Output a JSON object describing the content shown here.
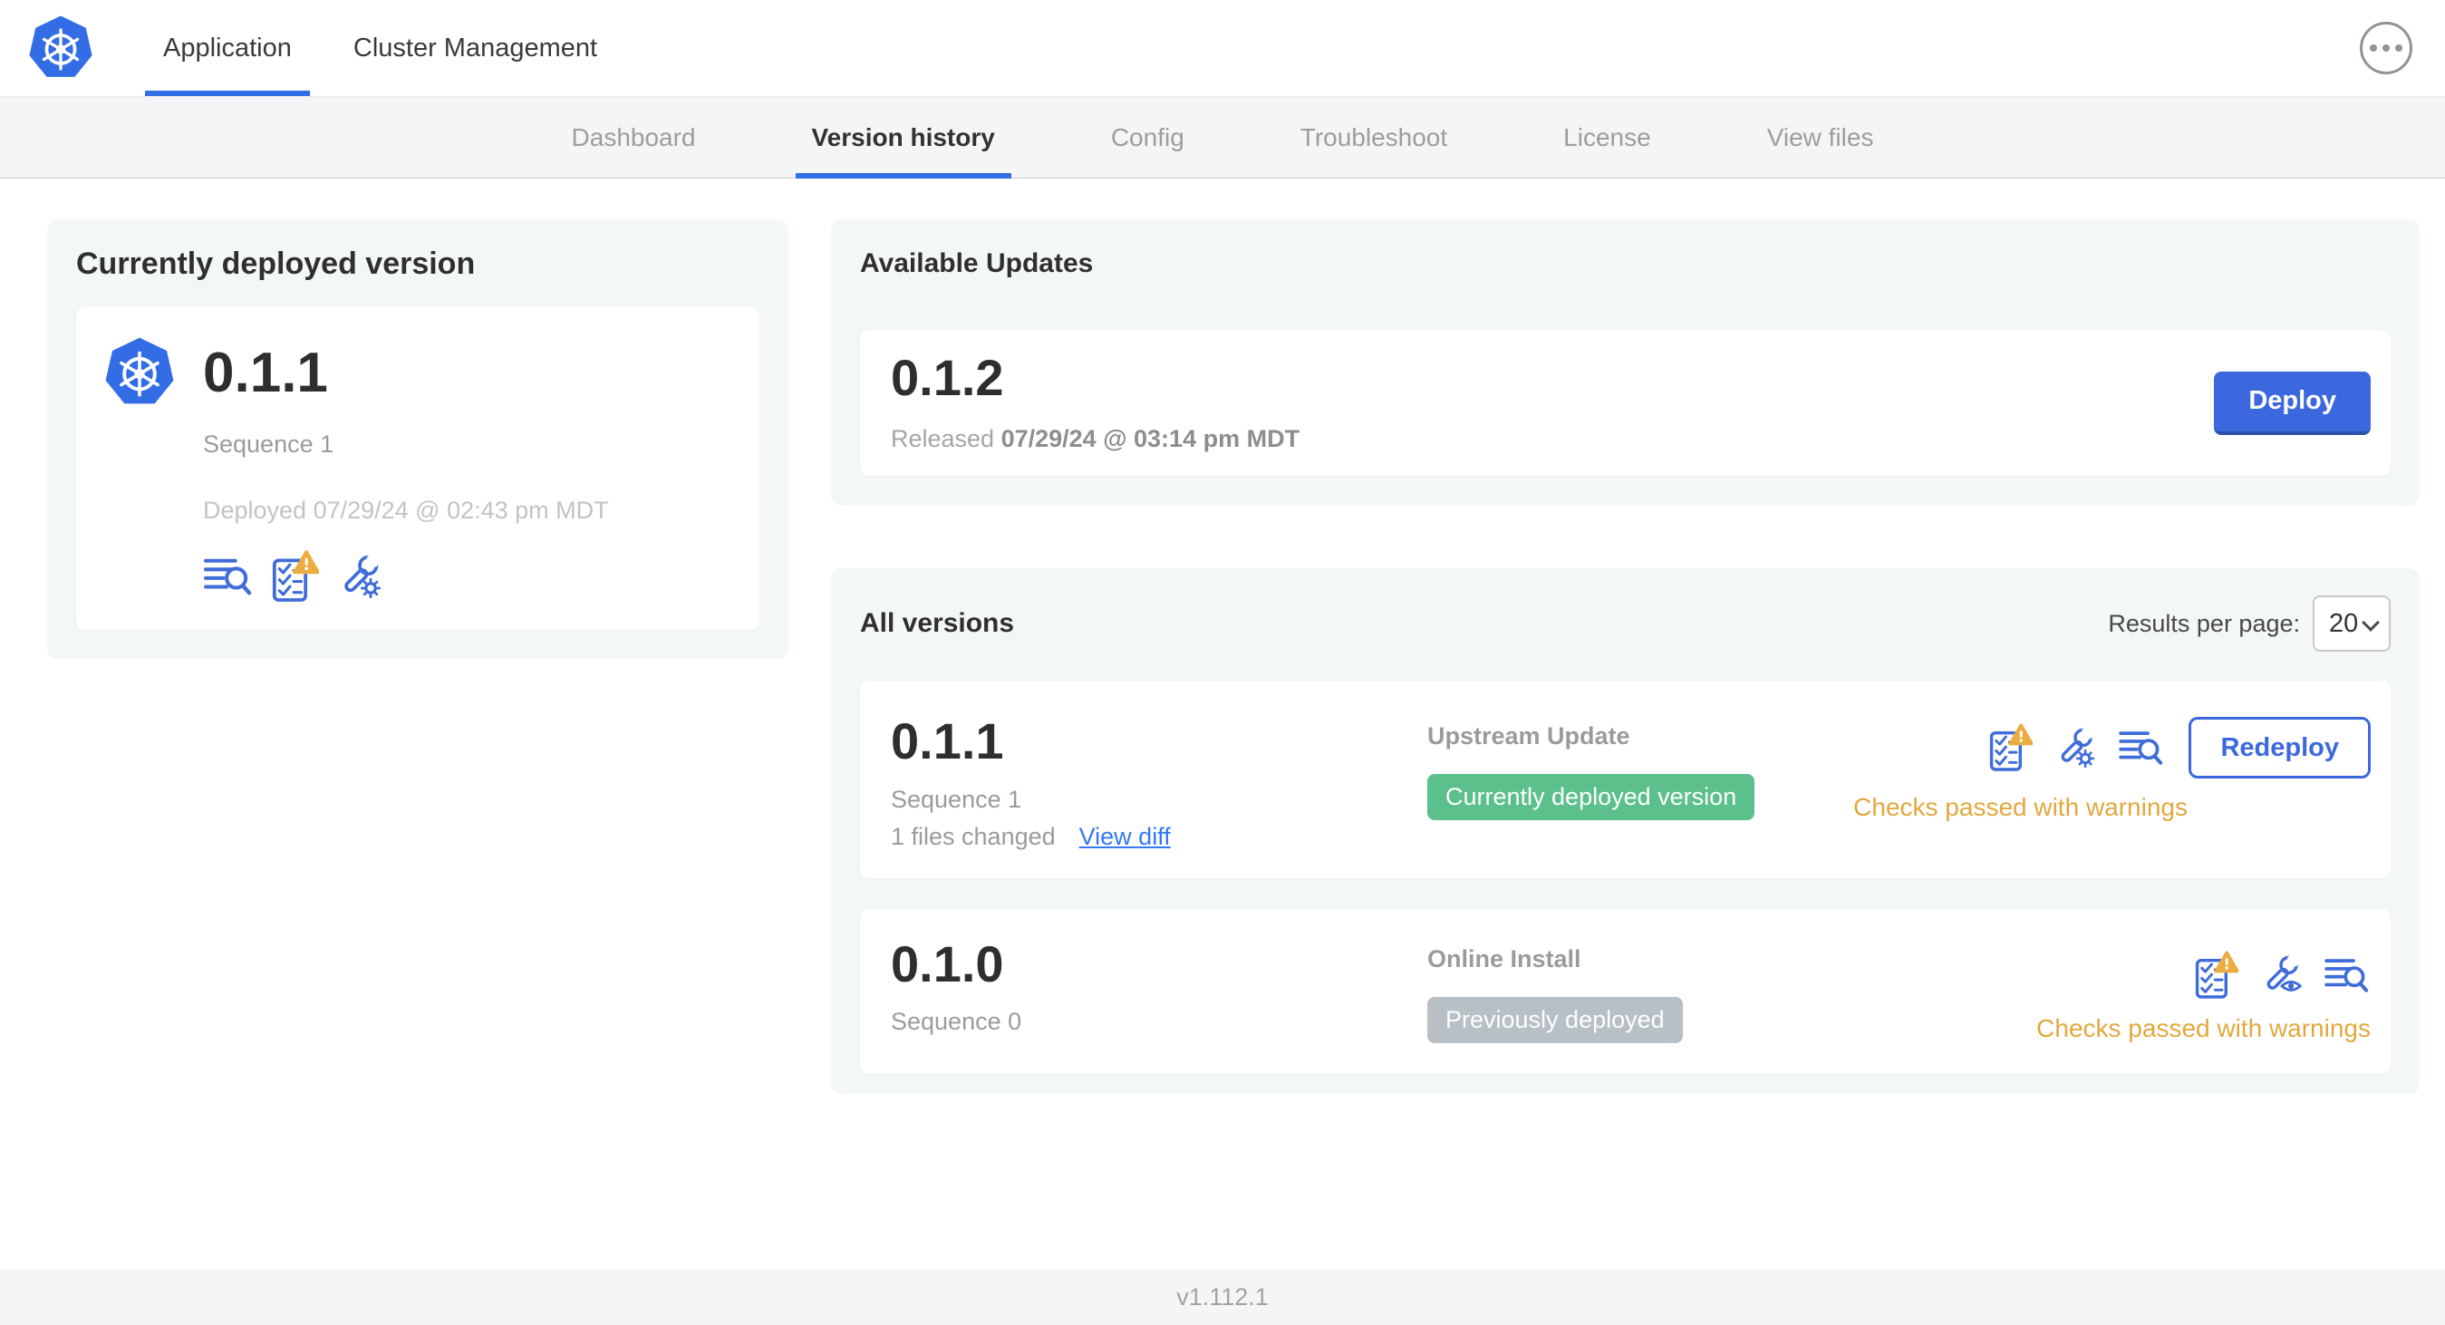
{
  "topnav": {
    "tabs": [
      {
        "label": "Application",
        "active": true
      },
      {
        "label": "Cluster Management",
        "active": false
      }
    ]
  },
  "subnav": {
    "tabs": [
      {
        "label": "Dashboard"
      },
      {
        "label": "Version history"
      },
      {
        "label": "Config"
      },
      {
        "label": "Troubleshoot"
      },
      {
        "label": "License"
      },
      {
        "label": "View files"
      }
    ],
    "active_tab": "Version history"
  },
  "deployed": {
    "title": "Currently deployed version",
    "version": "0.1.1",
    "sequence": "Sequence 1",
    "deployed_at": "Deployed 07/29/24 @ 02:43 pm MDT"
  },
  "updates": {
    "title": "Available Updates",
    "version": "0.1.2",
    "released_label": "Released",
    "released_at": "07/29/24 @ 03:14 pm MDT",
    "deploy_label": "Deploy"
  },
  "versions": {
    "title": "All versions",
    "results_label": "Results per page:",
    "results_value": "20",
    "rows": [
      {
        "version": "0.1.1",
        "sequence": "Sequence 1",
        "files_changed": "1 files changed",
        "diff_label": "View diff",
        "source": "Upstream Update",
        "badge": "Currently deployed version",
        "badge_bg": "#5cc08c",
        "status": "Checks passed with warnings",
        "action": "Redeploy"
      },
      {
        "version": "0.1.0",
        "sequence": "Sequence 0",
        "source": "Online Install",
        "badge": "Previously deployed",
        "badge_bg": "#b6c0c5",
        "status": "Checks passed with warnings"
      }
    ]
  },
  "footer": {
    "app_version": "v1.112.1"
  },
  "colors": {
    "primary_blue": "#3b68de",
    "kubernetes_blue": "#326DE6",
    "link_blue": "#3478f2",
    "icon_blue": "#3f6cd9",
    "warning_text": "#e2a83e",
    "warning_triangle": "#ecad40",
    "badge_green": "#5cc08c",
    "badge_gray": "#b6c0c5",
    "panel_bg": "#f4f7f8"
  },
  "icons": {
    "brand": "kubernetes-logo",
    "topnav_right": "ellipsis-icon",
    "deployed_card": [
      "release-notes-icon",
      "preflight-checks-warning-icon",
      "edit-config-icon"
    ],
    "version_row_current": [
      "preflight-checks-warning-icon",
      "edit-config-icon",
      "release-notes-icon"
    ],
    "version_row_old": [
      "preflight-checks-warning-icon",
      "view-config-icon",
      "release-notes-icon"
    ],
    "results_select": "chevron-down-icon"
  }
}
